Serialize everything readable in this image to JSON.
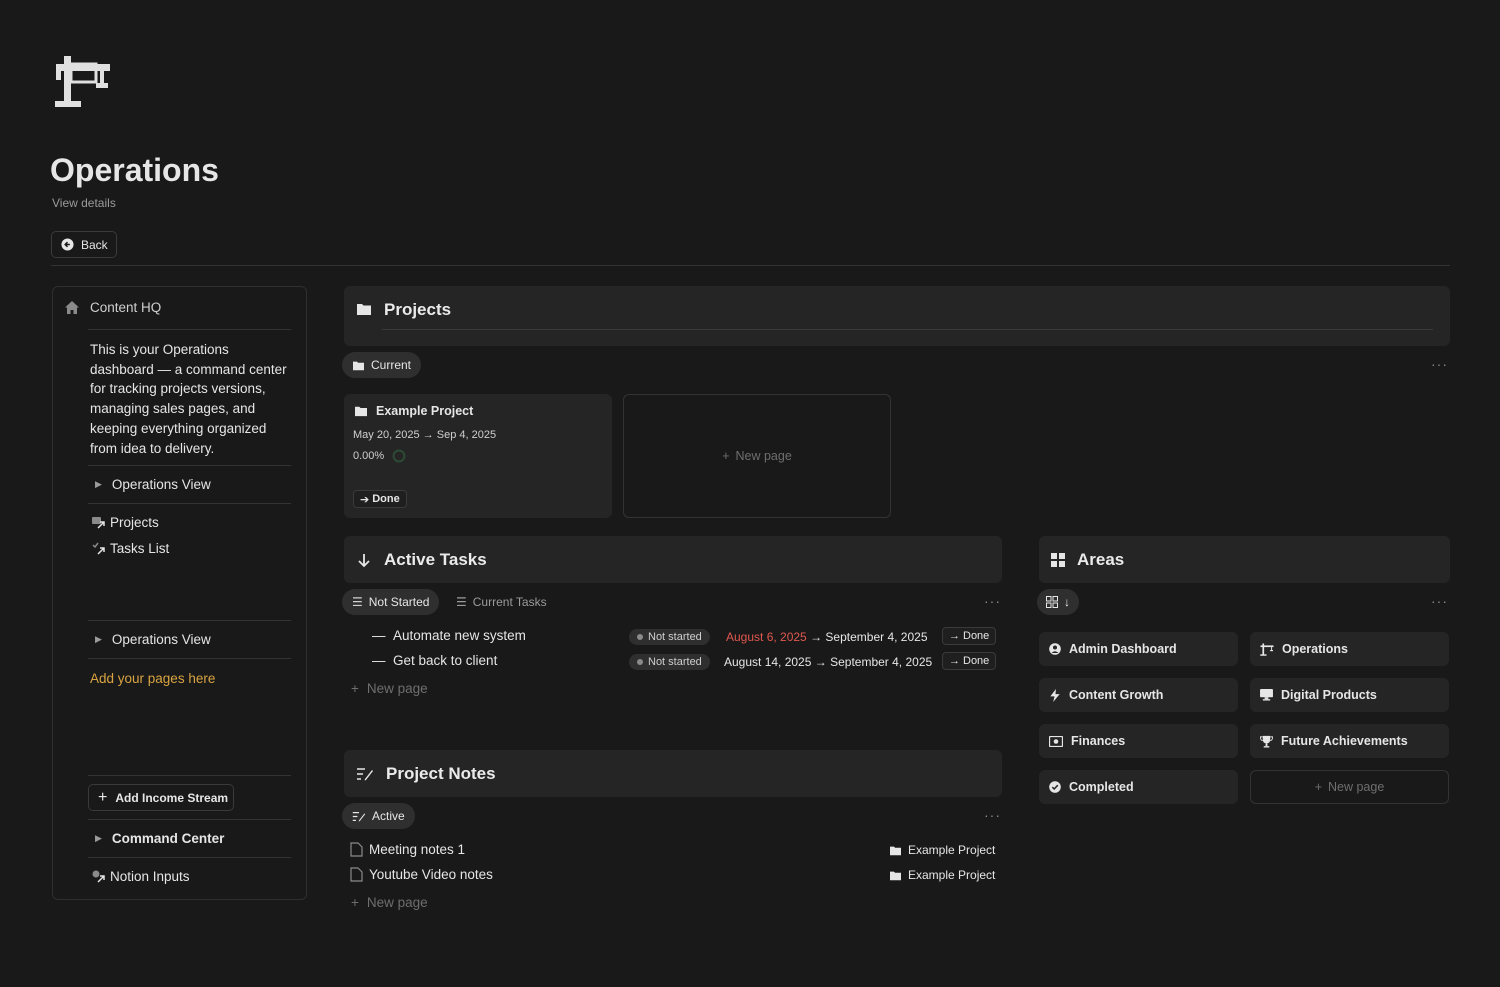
{
  "page": {
    "icon": "crane-icon",
    "title": "Operations",
    "view_details": "View details",
    "back_label": "Back"
  },
  "sidebar": {
    "header": {
      "icon": "home-icon",
      "label": "Content HQ"
    },
    "description": "This is your Operations dashboard — a command center for tracking projects versions, managing sales pages, and keeping everything organized from idea to delivery.",
    "toggle_1": "Operations View",
    "links": [
      {
        "label": "Projects",
        "icon": "linked-page-icon"
      },
      {
        "label": "Tasks List",
        "icon": "linked-page-icon"
      }
    ],
    "toggle_2": "Operations View",
    "add_pages": "Add your pages here",
    "add_income_button": "Add Income Stream",
    "toggle_3": "Command Center",
    "notion_inputs": "Notion Inputs"
  },
  "projects": {
    "title": "Projects",
    "view_tab": "Current",
    "card": {
      "title": "Example Project",
      "dates": "May 20, 2025 → Sep 4, 2025",
      "progress": "0.00%",
      "progress_value": 0,
      "done_label": "Done"
    },
    "new_page": "New page"
  },
  "active_tasks": {
    "title": "Active Tasks",
    "tabs": [
      "Not Started",
      "Current Tasks"
    ],
    "rows": [
      {
        "name": "Automate new system",
        "status": "Not started",
        "date_start": "August 6, 2025",
        "date_start_overdue": true,
        "date_end": "September 4, 2025",
        "done_label": "Done"
      },
      {
        "name": "Get back to client",
        "status": "Not started",
        "date_start": "August 14, 2025",
        "date_start_overdue": false,
        "date_end": "September 4, 2025",
        "done_label": "Done"
      }
    ],
    "new_page": "New page"
  },
  "areas": {
    "title": "Areas",
    "items": [
      {
        "label": "Admin Dashboard",
        "icon": "user-circle-icon"
      },
      {
        "label": "Operations",
        "icon": "crane-icon"
      },
      {
        "label": "Content Growth",
        "icon": "lightning-icon"
      },
      {
        "label": "Digital Products",
        "icon": "monitor-icon"
      },
      {
        "label": "Finances",
        "icon": "money-icon"
      },
      {
        "label": "Future Achievements",
        "icon": "trophy-icon"
      },
      {
        "label": "Completed",
        "icon": "check-circle-icon"
      }
    ],
    "new_page": "New page"
  },
  "project_notes": {
    "title": "Project Notes",
    "view_tab": "Active",
    "rows": [
      {
        "name": "Meeting notes 1",
        "project": "Example Project"
      },
      {
        "name": "Youtube Video notes",
        "project": "Example Project"
      }
    ],
    "new_page": "New page"
  },
  "colors": {
    "background": "#191919",
    "card": "#252525",
    "accent_orange": "#d9a441",
    "overdue_red": "#e0584f"
  }
}
